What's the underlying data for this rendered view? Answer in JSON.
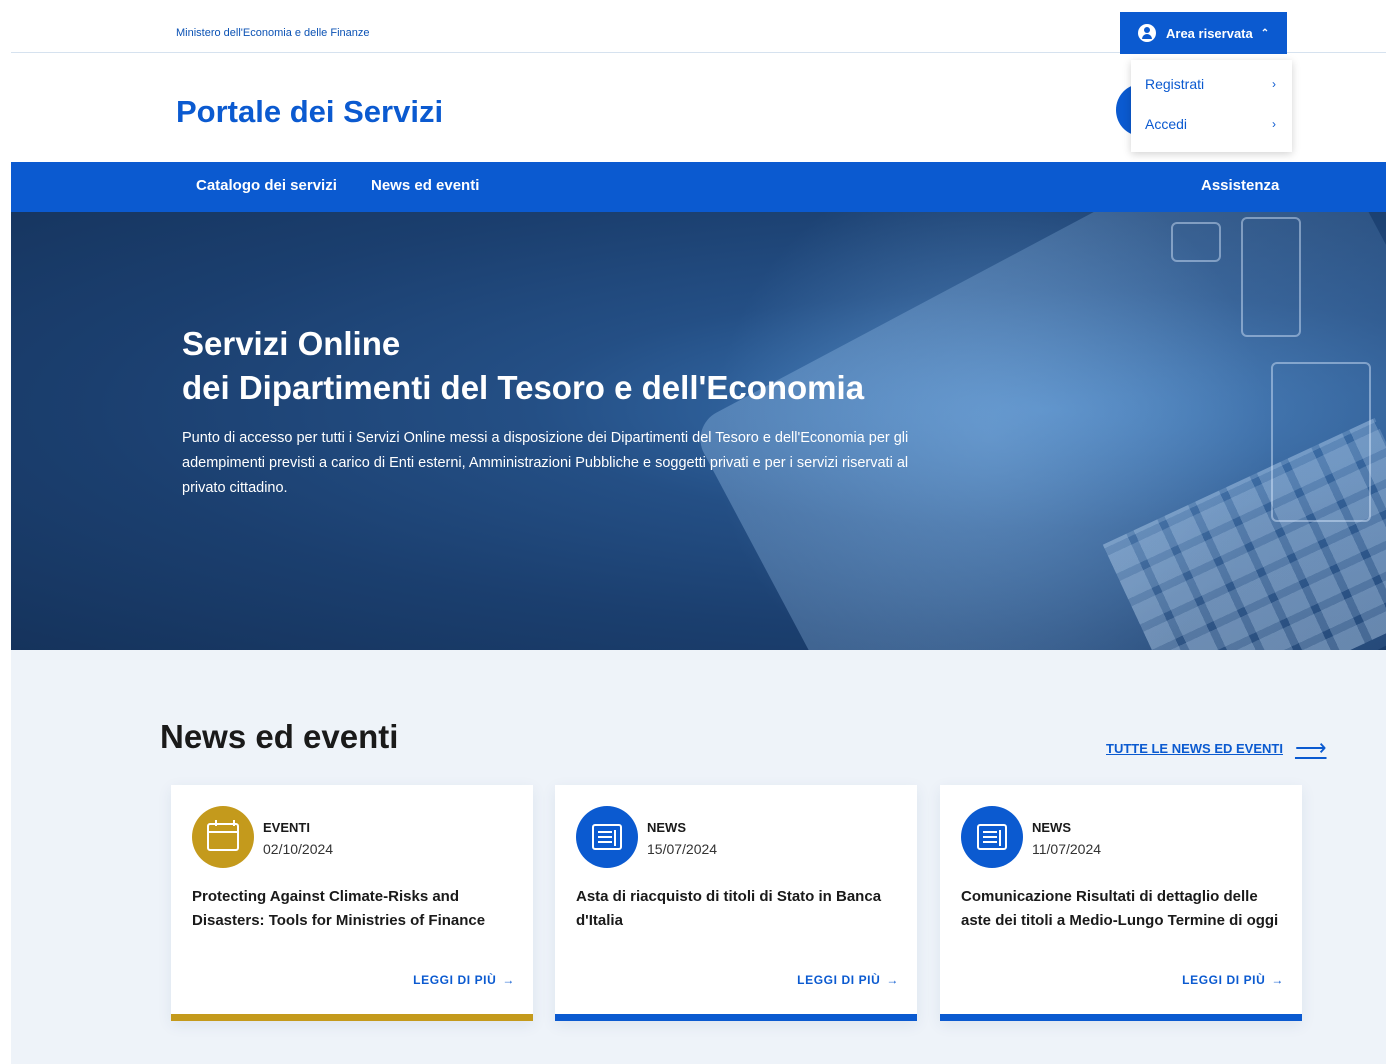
{
  "header": {
    "ministry": "Ministero dell'Economia e delle Finanze",
    "area_label": "Area riservata",
    "portal_title": "Portale dei Servizi"
  },
  "dropdown": {
    "items": [
      {
        "label": "Registrati"
      },
      {
        "label": "Accedi"
      }
    ]
  },
  "nav": {
    "items": [
      {
        "label": "Catalogo dei servizi"
      },
      {
        "label": "News ed eventi"
      }
    ],
    "right": "Assistenza"
  },
  "hero": {
    "title_line1": "Servizi Online",
    "title_line2": "dei Dipartimenti del Tesoro e dell'Economia",
    "description": "Punto di accesso per tutti i Servizi Online messi a disposizione dei Dipartimenti del Tesoro e dell'Economia per gli adempimenti previsti a carico di Enti esterni, Amministrazioni Pubbliche e soggetti privati e per i servizi riservati al privato cittadino."
  },
  "news": {
    "title": "News ed eventi",
    "all_link": "TUTTE LE NEWS ED EVENTI",
    "cards": [
      {
        "category": "EVENTI",
        "date": "02/10/2024",
        "text": "Protecting Against Climate-Risks and Disasters: Tools for Ministries of Finance",
        "more": "LEGGI DI PIÙ",
        "icon": "calendar-icon",
        "color": "#c49a1c"
      },
      {
        "category": "NEWS",
        "date": "15/07/2024",
        "text": "Asta di riacquisto di titoli di Stato in Banca d'Italia",
        "more": "LEGGI DI PIÙ",
        "icon": "news-icon",
        "color": "#0b5ad0"
      },
      {
        "category": "NEWS",
        "date": "11/07/2024",
        "text": "Comunicazione Risultati di dettaglio delle aste dei titoli a Medio-Lungo Termine di oggi",
        "more": "LEGGI DI PIÙ",
        "icon": "news-icon",
        "color": "#0b5ad0"
      }
    ]
  },
  "colors": {
    "primary": "#0b5ad0",
    "event": "#c49a1c",
    "section_bg": "#eef3f9"
  }
}
